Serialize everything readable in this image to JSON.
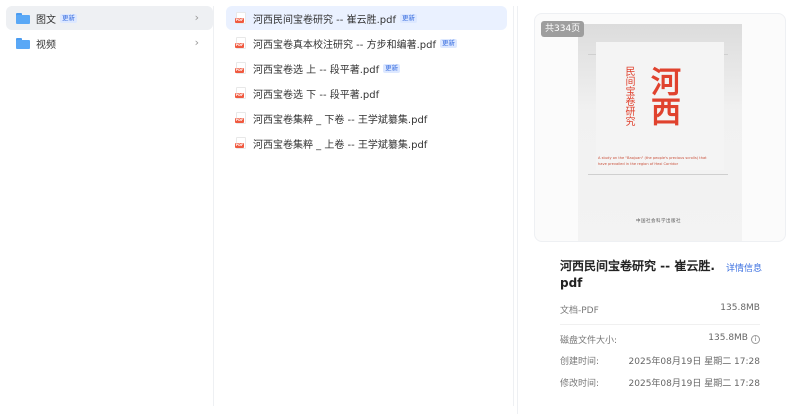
{
  "folders": [
    {
      "label": "图文",
      "badge": "更新",
      "active": true
    },
    {
      "label": "视频",
      "badge": "",
      "active": false
    }
  ],
  "files": [
    {
      "name": "河西民间宝卷研究 -- 崔云胜.pdf",
      "badge": "更新",
      "active": true
    },
    {
      "name": "河西宝卷真本校注研究 -- 方步和编著.pdf",
      "badge": "更新",
      "active": false
    },
    {
      "name": "河西宝卷选 上 -- 段平著.pdf",
      "badge": "更新",
      "active": false
    },
    {
      "name": "河西宝卷选 下 -- 段平著.pdf",
      "badge": "",
      "active": false
    },
    {
      "name": "河西宝卷集粹 _ 下卷 -- 王学斌纂集.pdf",
      "badge": "",
      "active": false
    },
    {
      "name": "河西宝卷集粹 _ 上卷 -- 王学斌纂集.pdf",
      "badge": "",
      "active": false
    }
  ],
  "icons": {
    "folder": "folder-icon",
    "pdf": "pdf-file-icon",
    "chevron": "chevron-right-icon",
    "info": "info-circle-icon",
    "chevron_glyph": "›",
    "info_glyph": "i",
    "pdf_tag": "PDF"
  },
  "colors": {
    "folder_blue": "#5aa8f6",
    "badge_bg": "#dde8ff",
    "badge_text": "#3a6fe0",
    "active_file_bg": "#eaf1ff",
    "active_folder_bg": "#eef0f3",
    "link": "#3a6fe0",
    "cover_red": "#e0422e"
  },
  "preview": {
    "pages_badge": "共334页",
    "cover": {
      "title_big": "河西",
      "title_small": "民间宝卷研究",
      "english": "A study on the \"Baojuan\" (the people's precious scrolls) that have prevailed in the region of Hexi Corridor",
      "publisher": "中国社会科学出版社"
    }
  },
  "details": {
    "title": "河西民间宝卷研究 -- 崔云胜.pdf",
    "detail_link": "详情信息",
    "type_label": "文档-PDF",
    "type_size": "135.8MB",
    "disk_label": "磁盘文件大小:",
    "disk_value": "135.8MB",
    "created_label": "创建时间:",
    "created_value": "2025年08月19日 星期二 17:28",
    "modified_label": "修改时间:",
    "modified_value": "2025年08月19日 星期二 17:28"
  }
}
